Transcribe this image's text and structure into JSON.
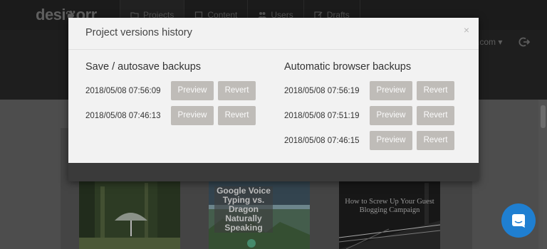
{
  "app": {
    "logo_text": "desi",
    "nav": [
      {
        "label": "Projects",
        "icon": "folder-icon"
      },
      {
        "label": "Content",
        "icon": "content-icon"
      },
      {
        "label": "Users",
        "icon": "users-icon"
      },
      {
        "label": "Drafts",
        "icon": "edit-icon"
      }
    ],
    "account_text": ".com ▾",
    "logout_icon": "logout-icon"
  },
  "cards": [
    {
      "title": ""
    },
    {
      "title": "Google Voice Typing vs. Dragon Naturally Speaking"
    },
    {
      "title": "How to Screw Up Your Guest Blogging Campaign"
    }
  ],
  "modal": {
    "title": "Project versions history",
    "close_glyph": "×",
    "left_column": {
      "heading": "Save / autosave backups",
      "rows": [
        {
          "timestamp": "2018/05/08 07:56:09",
          "preview_label": "Preview",
          "revert_label": "Revert"
        },
        {
          "timestamp": "2018/05/08 07:46:13",
          "preview_label": "Preview",
          "revert_label": "Revert"
        }
      ]
    },
    "right_column": {
      "heading": "Automatic browser backups",
      "rows": [
        {
          "timestamp": "2018/05/08 07:56:19",
          "preview_label": "Preview",
          "revert_label": "Revert"
        },
        {
          "timestamp": "2018/05/08 07:51:19",
          "preview_label": "Preview",
          "revert_label": "Revert"
        },
        {
          "timestamp": "2018/05/08 07:46:15",
          "preview_label": "Preview",
          "revert_label": "Revert"
        }
      ]
    }
  },
  "chat": {
    "icon": "chat-icon",
    "color": "#1f7fd1"
  }
}
